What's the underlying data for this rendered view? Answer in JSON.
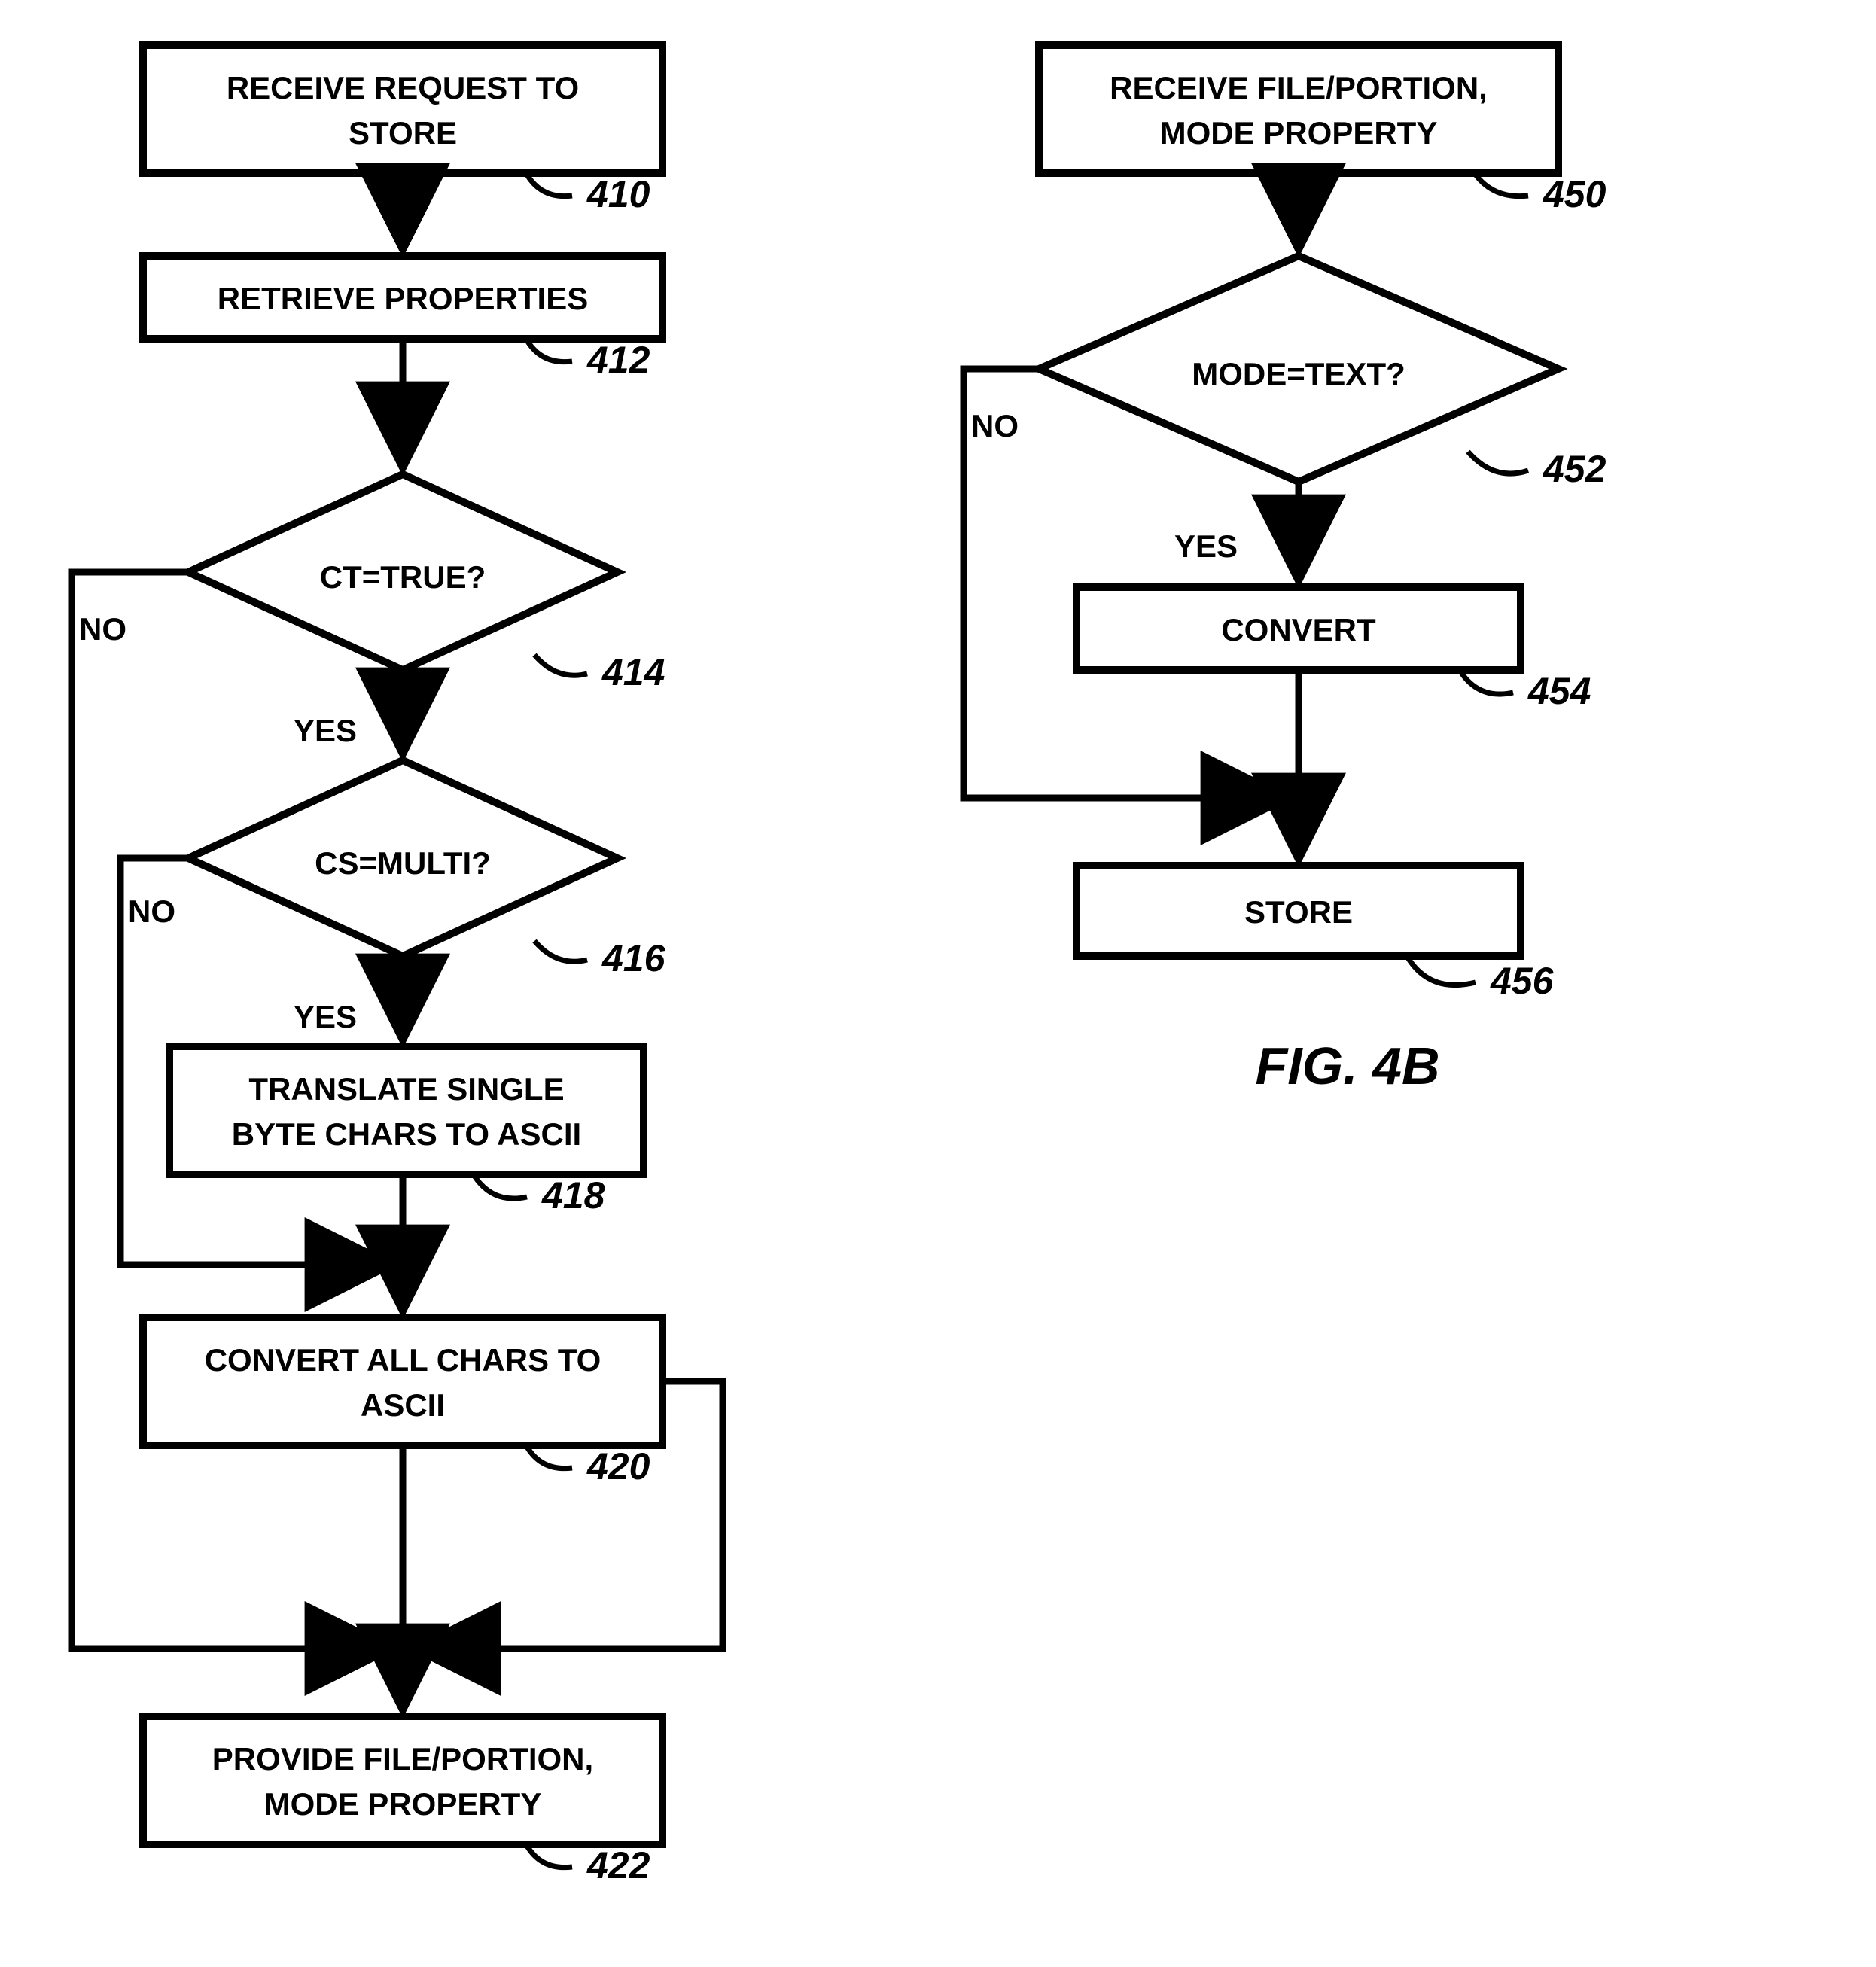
{
  "left": {
    "b410_l1": "RECEIVE REQUEST TO",
    "b410_l2": "STORE",
    "b412": "RETRIEVE PROPERTIES",
    "d414": "CT=TRUE?",
    "d416": "CS=MULTI?",
    "b418_l1": "TRANSLATE SINGLE",
    "b418_l2": "BYTE CHARS TO ASCII",
    "b420_l1": "CONVERT ALL CHARS TO",
    "b420_l2": "ASCII",
    "b422_l1": "PROVIDE FILE/PORTION,",
    "b422_l2": "MODE PROPERTY",
    "r410": "410",
    "r412": "412",
    "r414": "414",
    "r416": "416",
    "r418": "418",
    "r420": "420",
    "r422": "422",
    "no": "NO",
    "yes": "YES"
  },
  "right": {
    "b450_l1": "RECEIVE FILE/PORTION,",
    "b450_l2": "MODE PROPERTY",
    "d452": "MODE=TEXT?",
    "b454": "CONVERT",
    "b456": "STORE",
    "r450": "450",
    "r452": "452",
    "r454": "454",
    "r456": "456",
    "no": "NO",
    "yes": "YES",
    "fig": "FIG. 4B"
  }
}
